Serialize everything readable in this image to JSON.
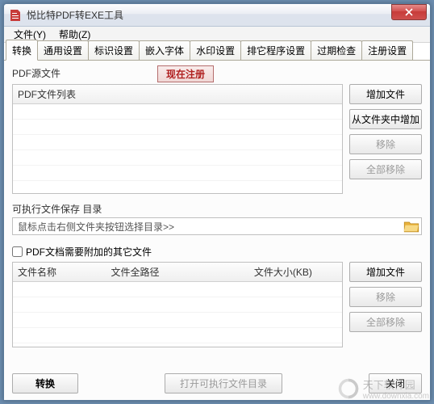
{
  "window": {
    "title": "悦比特PDF转EXE工具"
  },
  "menu": {
    "file": "文件(Y)",
    "help": "帮助(Z)"
  },
  "tabs": [
    {
      "label": "转换",
      "active": true
    },
    {
      "label": "通用设置",
      "active": false
    },
    {
      "label": "标识设置",
      "active": false
    },
    {
      "label": "嵌入字体",
      "active": false
    },
    {
      "label": "水印设置",
      "active": false
    },
    {
      "label": "排它程序设置",
      "active": false
    },
    {
      "label": "过期检查",
      "active": false
    },
    {
      "label": "注册设置",
      "active": false
    }
  ],
  "register_btn": "现在注册",
  "source": {
    "label": "PDF源文件",
    "col": "PDF文件列表",
    "buttons": {
      "add_file": "增加文件",
      "add_folder": "从文件夹中增加",
      "remove": "移除",
      "remove_all": "全部移除"
    }
  },
  "exec_dir": {
    "label": "可执行文件保存 目录",
    "placeholder": "鼠标点击右侧文件夹按钮选择目录>>"
  },
  "attach": {
    "check_label": "PDF文档需要附加的其它文件",
    "cols": {
      "name": "文件名称",
      "path": "文件全路径",
      "size": "文件大小(KB)"
    },
    "buttons": {
      "add_file": "增加文件",
      "remove": "移除",
      "remove_all": "全部移除"
    }
  },
  "bottom": {
    "convert": "转换",
    "open_dir": "打开可执行文件目录",
    "close": "关闭"
  },
  "watermark": {
    "text": "天下软件园",
    "sub": "www.downxia.com"
  }
}
